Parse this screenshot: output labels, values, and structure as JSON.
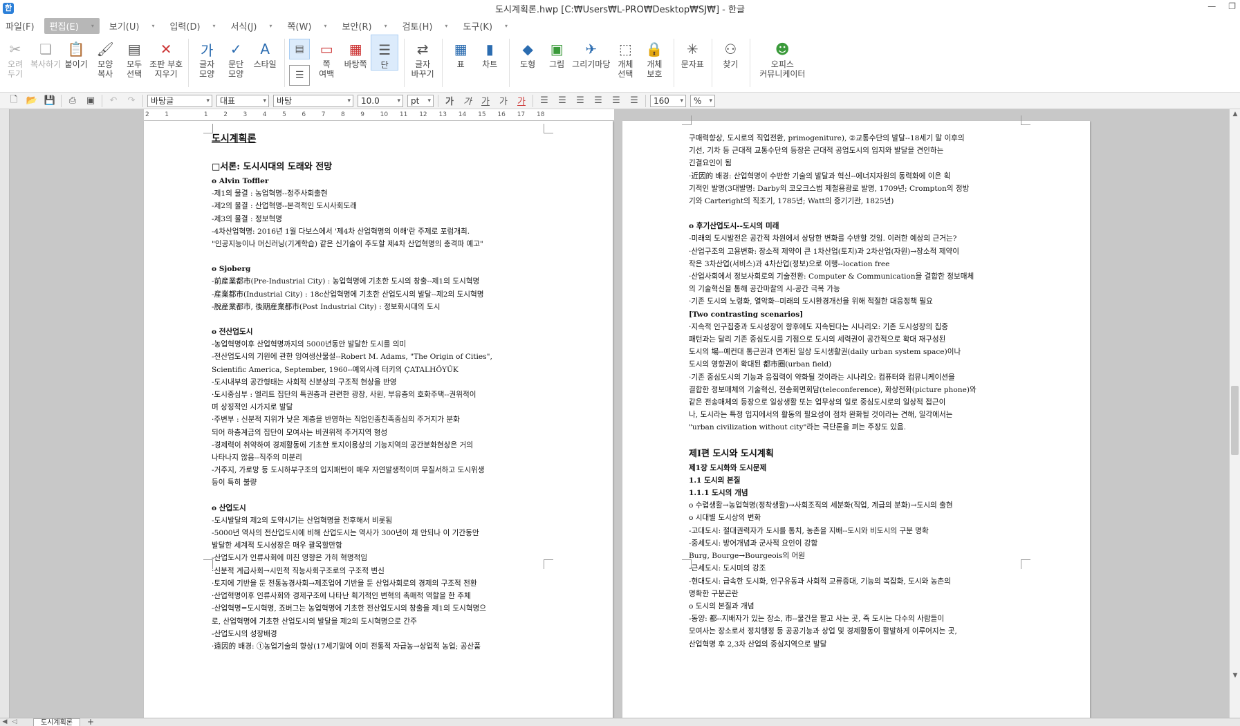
{
  "window": {
    "title": "도시계획론.hwp [C:₩Users₩L-PRO₩Desktop₩SJ₩] - 한글",
    "app_icon": "한"
  },
  "menu": [
    {
      "label": "파일(F)",
      "active": false
    },
    {
      "label": "편집(E)",
      "active": true
    },
    {
      "label": "보기(U)",
      "active": false
    },
    {
      "label": "입력(D)",
      "active": false
    },
    {
      "label": "서식(J)",
      "active": false
    },
    {
      "label": "쪽(W)",
      "active": false
    },
    {
      "label": "보안(R)",
      "active": false
    },
    {
      "label": "검토(H)",
      "active": false
    },
    {
      "label": "도구(K)",
      "active": false
    }
  ],
  "ribbon": {
    "cut": "오려\n두기",
    "copy": "복사하기",
    "paste": "붙이기",
    "format_copy": "모양\n복사",
    "select_all": "모두\n선택",
    "del_marks": "조판 부호\n지우기",
    "char_shape": "글자\n모양",
    "para_shape": "문단\n모양",
    "style": "스타일",
    "page_margin": "쪽\n여백",
    "background": "바탕쪽",
    "column": "단",
    "char_replace": "글자\n바꾸기",
    "table": "표",
    "chart": "차트",
    "shape": "도형",
    "picture": "그림",
    "gallery": "그리기마당",
    "obj_select": "개체\n선택",
    "obj_protect": "개체\n보호",
    "symbols": "문자표",
    "find": "찾기",
    "office_comm": "오피스\n커뮤니케이터"
  },
  "toolbar": {
    "style_name": "바탕글",
    "lang": "대표",
    "font": "바탕",
    "font_size": "10.0",
    "unit": "pt",
    "line_spacing": "160",
    "percent": "%"
  },
  "ruler": [
    "2",
    "1",
    "",
    "1",
    "2",
    "3",
    "4",
    "5",
    "6",
    "7",
    "8",
    "9",
    "10",
    "11",
    "12",
    "13",
    "14",
    "15",
    "16",
    "17",
    "18"
  ],
  "left_page": [
    {
      "t": "도시계획론",
      "c": "h1"
    },
    {
      "t": "",
      "c": "gap"
    },
    {
      "t": "□서론: 도시시대의 도래와 전망",
      "c": "h2"
    },
    {
      "t": "o Alvin Toffler",
      "c": "h3"
    },
    {
      "t": "-제1의 물결 : 농업혁명--정주사회출현",
      "c": ""
    },
    {
      "t": "-제2의 물결 : 산업혁명--본격적인 도시사회도래",
      "c": ""
    },
    {
      "t": "-제3의 물결 : 정보혁명",
      "c": ""
    },
    {
      "t": "-4차산업혁명: 2016년 1월 다보스에서 '제4차 산업혁명의 이해'란 주제로 포럼개최.",
      "c": ""
    },
    {
      "t": " \"인공지능이나 머신러닝(기계학습) 같은 신기술이 주도할 제4차 산업혁명의 충격파 예고\"",
      "c": ""
    },
    {
      "t": "",
      "c": "gap"
    },
    {
      "t": "o Sjoberg",
      "c": "h3"
    },
    {
      "t": "-前産業都市(Pre-Industrial City) : 농업혁명에 기초한 도시의 창출--제1의 도시혁명",
      "c": ""
    },
    {
      "t": "-産業都市(Industrial City) : 18c산업혁명에 기초한 산업도시의 발달--제2의 도시혁명",
      "c": ""
    },
    {
      "t": "-脫産業都市, 後期産業都市(Post Industrial City) : 정보화시대의 도시",
      "c": ""
    },
    {
      "t": "",
      "c": "gap"
    },
    {
      "t": "o 전산업도시",
      "c": "h3"
    },
    {
      "t": "-농업혁명이후 산업혁명까지의 5000년동안 발달한 도시를 의미",
      "c": ""
    },
    {
      "t": "-전산업도시의 기원에 관한 잉여생산물설--Robert M. Adams, \"The Origin of Cities\",",
      "c": ""
    },
    {
      "t": "   Scientific America, September, 1960--예외사례 터키의 ÇATALHÖYÜK",
      "c": ""
    },
    {
      "t": "-도시내부의 공간형태는 사회적 신분상의 구조적 현상을 반영",
      "c": ""
    },
    {
      "t": " ·도시중심부 : 엘리트 집단의 특권층과 관련한 광장, 사원, 부유층의 호화주택--권위적이",
      "c": ""
    },
    {
      "t": "                   며 상징적인 시가지로 발달",
      "c": ""
    },
    {
      "t": " ·주변부 : 신분적 지위가 낮은 계층을 반영하는 직업인종친족중심의 주거지가 분화",
      "c": ""
    },
    {
      "t": "                되어 하층계급의 집단이 모여사는 비권위적 주거지역 형성",
      "c": ""
    },
    {
      "t": "-경제력이 취약하여 경제활동에 기초한 토지이용상의 기능지역의 공간분화현상은 거의",
      "c": ""
    },
    {
      "t": " 나타나지 않음--직주의 미분리",
      "c": ""
    },
    {
      "t": "-거주지, 가로망 등 도시하부구조의 입지패턴이 매우 자연발생적이며 무질서하고 도시위생",
      "c": ""
    },
    {
      "t": " 등이 특히 불량",
      "c": ""
    },
    {
      "t": "",
      "c": "gap"
    },
    {
      "t": "o 산업도시",
      "c": "h3"
    },
    {
      "t": "-도시발달의 제2의 도약시기는 산업혁명을 전후해서 비롯됨",
      "c": ""
    },
    {
      "t": "-5000년 역사의 전산업도시에 비해 산업도시는 역사가 300년이 채 안되나 이 기간동안",
      "c": ""
    },
    {
      "t": " 발달한 세계적 도시성장은 매우 괄목할만함",
      "c": ""
    },
    {
      "t": "-산업도시가 인류사회에 미친 영향은 가히 혁명적임",
      "c": ""
    },
    {
      "t": " ·신분적 계급사회→시민적 직능사회구조로의 구조적 변신",
      "c": ""
    },
    {
      "t": " ·토지에 기반을 둔 전통농경사회→제조업에 기반을 둔 산업사회로의 경제의 구조적 전환",
      "c": ""
    },
    {
      "t": " ·산업혁명이후 인류사회와 경제구조에 나타난 획기적인 변혁의 촉매적 역할을 한 주체",
      "c": ""
    },
    {
      "t": "-산업혁명=도시혁명, 죠버그는 농업혁명에 기초한 전산업도시의 창출을 제1의 도시혁명으",
      "c": ""
    },
    {
      "t": " 로, 산업혁명에 기초한 산업도시의 발달을 제2의 도시혁명으로 간주",
      "c": ""
    },
    {
      "t": "-산업도시의 성장배경",
      "c": ""
    },
    {
      "t": " ·遠因的 배경: ①농업기술의 향상(17세기말에 이미 전통적 자급농→상업적 농업; 공산품",
      "c": ""
    }
  ],
  "right_page": [
    {
      "t": "  구매력향상, 도시로의 직업전환, primogeniture), ②교통수단의 발달--18세기 말 이후의",
      "c": ""
    },
    {
      "t": "  기선, 기차 등 근대적 교통수단의 등장은 근대적 공업도시의 입지와 발달을 견인하는",
      "c": ""
    },
    {
      "t": "  긴결요인이 됨",
      "c": ""
    },
    {
      "t": " ·近因的 배경: 산업혁명이 수반한 기술의 발달과 혁신--에너지자원의 동력화에 이은 획",
      "c": ""
    },
    {
      "t": "  기적인 발명(3대발명: Darby의 코오크스법 제철용광로 발명, 1709년; Crompton의 정방",
      "c": ""
    },
    {
      "t": "  기와 Carteright의 직조기, 1785년; Watt의 증기기관, 1825년)",
      "c": ""
    },
    {
      "t": "",
      "c": "gap"
    },
    {
      "t": "o 후기산업도시--도시의 미래",
      "c": "h3"
    },
    {
      "t": "-미래의 도시발전은 공간적 차원에서 상당한 변화를 수반할 것임. 이러한 예상의 근거는?",
      "c": ""
    },
    {
      "t": " ·산업구조의 고용변화: 장소적 제약이 큰 1차산업(토지)과 2차산업(자원)→장소적 제약이",
      "c": ""
    },
    {
      "t": "  작은 3차산업(서비스)과 4차산업(정보)으로 이행--location free",
      "c": ""
    },
    {
      "t": " ·산업사회에서 정보사회로의 기술전환: Computer & Communication을 결합한 정보매체",
      "c": ""
    },
    {
      "t": "  의 기술혁신을 통해 공간마찰의 시-공간 극복 가능",
      "c": ""
    },
    {
      "t": " ·기존 도시의 노령화, 열악화--미래의 도시환경개선을 위해 적절한 대응정책 필요",
      "c": ""
    },
    {
      "t": "[Two contrasting scenarios]",
      "c": "h3"
    },
    {
      "t": " ·지속적 인구집중과 도시성장이 향후에도 지속된다는 시나리오: 기존 도시성장의 집중",
      "c": ""
    },
    {
      "t": "  패턴과는 달리 기존 중심도시를 기점으로 도시의 세력권이 공간적으로 확대 재구성된",
      "c": ""
    },
    {
      "t": "  도시의 場--예컨대 통근권과 연계된 일상 도시생활권(daily urban system space)이나",
      "c": ""
    },
    {
      "t": "  도시의 영향권이 확대된 都市圈(urban field)",
      "c": ""
    },
    {
      "t": " ·기존 중심도시의 기능과 응집력이 약화될 것이라는 시나리오: 컴퓨터와 컴뮤니케이션을",
      "c": ""
    },
    {
      "t": "  결합한 정보매체의 기술혁신, 전송회면회담(teleconference), 화상전화(picture phone)와",
      "c": ""
    },
    {
      "t": "  같은 전송매체의 등장으로 일상생활 또는 업무상의 일로 중심도시로의 일상적 접근이",
      "c": ""
    },
    {
      "t": "  나, 도시라는 특정 입지에서의 활동의 필요성이 점차 완화될 것이라는 견해, 일각에서는",
      "c": ""
    },
    {
      "t": "  \"urban civilization without city\"라는 극단론을 펴는 주장도 있음.",
      "c": ""
    },
    {
      "t": "",
      "c": "gap"
    },
    {
      "t": "제Ⅰ편 도시와 도시계획",
      "c": "h2"
    },
    {
      "t": "제1장 도시화와 도시문제",
      "c": "h3"
    },
    {
      "t": "1.1 도시의 본질",
      "c": "h3"
    },
    {
      "t": "1.1.1 도시의 개념",
      "c": "h3"
    },
    {
      "t": "o 수렵생활→농업혁명(정착생활)→사회조직의 세분화(직업, 계급의 분화)→도시의 출현",
      "c": ""
    },
    {
      "t": "o 시대별 도시상의 변화",
      "c": ""
    },
    {
      "t": "-고대도시: 절대권력자가 도시를 통치, 농촌을 지배--도시와 비도시의 구분 명확",
      "c": ""
    },
    {
      "t": "-중세도시: 방어개념과 군사적 요인이 강함",
      "c": ""
    },
    {
      "t": "                 Burg, Bourge→Bourgeois의 어원",
      "c": ""
    },
    {
      "t": "-근세도시: 도시미의 강조",
      "c": ""
    },
    {
      "t": "-현대도시: 급속한 도시화, 인구유동과 사회적 교류증대, 기능의 복잡화, 도시와 농촌의",
      "c": ""
    },
    {
      "t": " 명확한 구분곤란",
      "c": ""
    },
    {
      "t": "o 도시의 본질과 개념",
      "c": ""
    },
    {
      "t": "-동양: 都--지배자가 있는 장소, 市--물건을 팔고 사는 곳, 즉 도시는 다수의 사람들이",
      "c": ""
    },
    {
      "t": " 모여사는 장소로서 정치행정 등 공공기능과 상업 및 경제활동이 활발하게 이루어지는 곳,",
      "c": ""
    },
    {
      "t": " 산업혁명 후 2,3차 산업의 중심지역으로 발달",
      "c": ""
    }
  ],
  "bottom": {
    "tab_name": "도시계획론",
    "add": "+"
  }
}
